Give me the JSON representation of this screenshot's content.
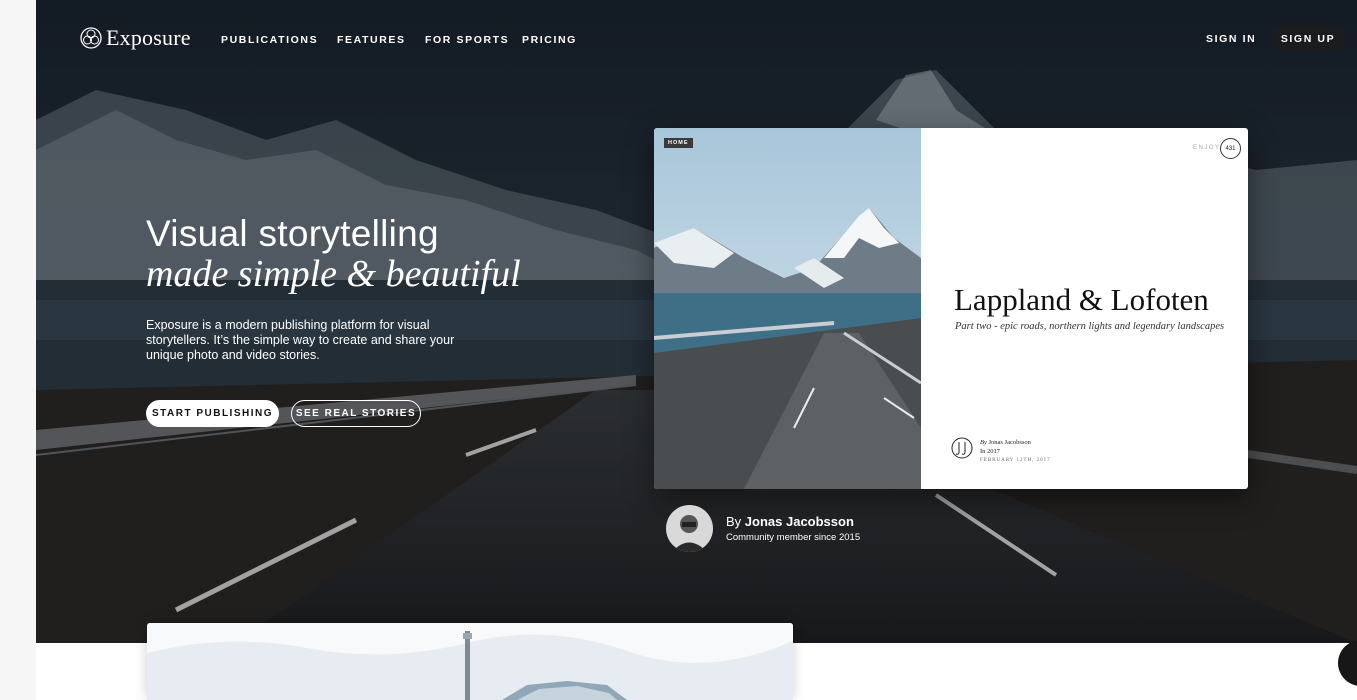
{
  "nav": {
    "logo_text": "Exposure",
    "links": [
      "PUBLICATIONS",
      "FEATURES",
      "FOR SPORTS",
      "PRICING"
    ],
    "sign_in": "SIGN IN",
    "sign_up": "SIGN UP"
  },
  "hero": {
    "headline": "Visual storytelling",
    "headline_italic": "made simple & beautiful",
    "description": "Exposure is a modern publishing platform for visual storytellers. It’s the simple way to create and share your unique photo and video stories.",
    "primary_button": "START PUBLISHING",
    "secondary_button": "SEE REAL STORIES"
  },
  "preview": {
    "tag": "HOME",
    "enjoy": "ENJOY",
    "count": "431",
    "title": "Lappland & Lofoten",
    "subtitle": "Part two - epic roads, northern lights and legendary landscapes",
    "byline_by": "By",
    "byline_author": "Jonas Jacobsson",
    "byline_year": "In 2017",
    "byline_date": "FEBRUARY 12TH, 2017"
  },
  "author": {
    "prefix": "By",
    "name": "Jonas Jacobsson",
    "since": "Community member since 2015"
  },
  "colors": {
    "hero_overlay": "#2c3946",
    "signup_bg": "#1b1c1d",
    "card_bg": "#ffffff"
  }
}
